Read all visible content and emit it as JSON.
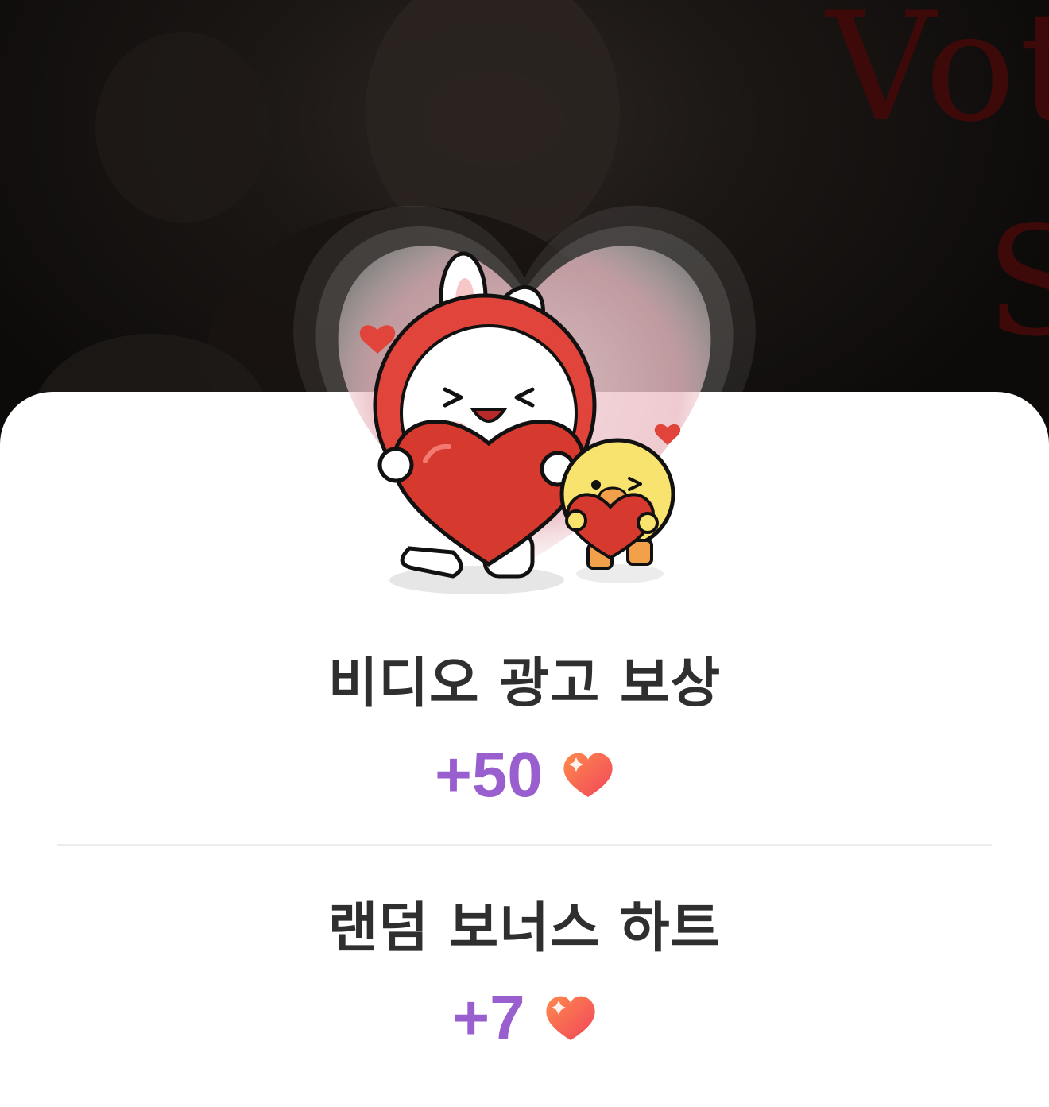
{
  "background": {
    "overlay_text": [
      "Vot",
      "S"
    ],
    "accent_color": "#3d0a09"
  },
  "rewards": [
    {
      "title": "비디오 광고 보상",
      "amount": "+50",
      "icon": "heart-icon"
    },
    {
      "title": "랜덤 보너스 하트",
      "amount": "+7",
      "icon": "heart-icon"
    }
  ],
  "colors": {
    "amount": "#9a5fcf",
    "title": "#2f2f2f",
    "heart_gradient": [
      "#ff8a4c",
      "#f0455b"
    ],
    "sheet": "#ffffff"
  },
  "illustration": "bunny-and-chick-holding-hearts"
}
